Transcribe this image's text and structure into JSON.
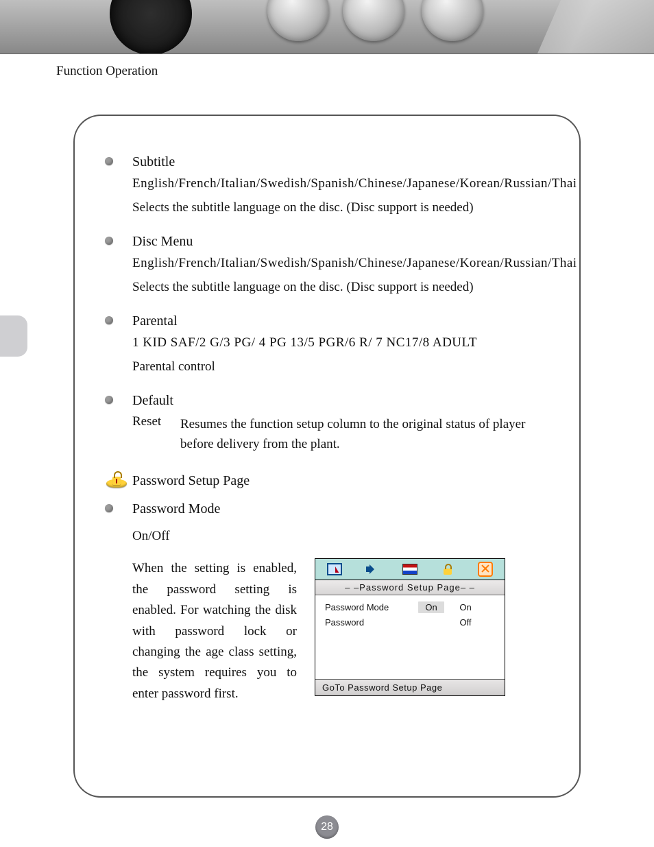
{
  "section_label": "Function Operation",
  "items": {
    "subtitle": {
      "title": "Subtitle",
      "options": "English/French/Italian/Swedish/Spanish/Chinese/Japanese/Korean/Russian/Thai",
      "desc": "Selects the subtitle language on the disc. (Disc support is needed)"
    },
    "disc_menu": {
      "title": "Disc  Menu",
      "options": "English/French/Italian/Swedish/Spanish/Chinese/Japanese/Korean/Russian/Thai",
      "desc": "Selects the subtitle language on the disc. (Disc support is needed)"
    },
    "parental": {
      "title": "Parental",
      "options": "1 KID SAF/2 G/3 PG/ 4 PG 13/5 PGR/6 R/ 7 NC17/8 ADULT",
      "desc": "Parental control"
    },
    "default": {
      "title": "Default",
      "reset_label": "Reset",
      "reset_desc": "Resumes the function setup column to the original status  of player before delivery from the plant."
    },
    "password_setup_heading": "Password  Setup  Page",
    "password_mode": {
      "title": "Password  Mode",
      "options": "On/Off",
      "desc": "When the setting is enabled, the password setting is enabled. For watching the disk with password lock or changing the age class setting, the system requires you to enter password first."
    }
  },
  "osd": {
    "title": "– –Password  Setup  Page– –",
    "rows": [
      {
        "label": "Password Mode",
        "value": "On",
        "opt": "On"
      },
      {
        "label": "Password",
        "value": "",
        "opt": "Off"
      }
    ],
    "footer": "GoTo  Password  Setup  Page"
  },
  "page_number": "28"
}
